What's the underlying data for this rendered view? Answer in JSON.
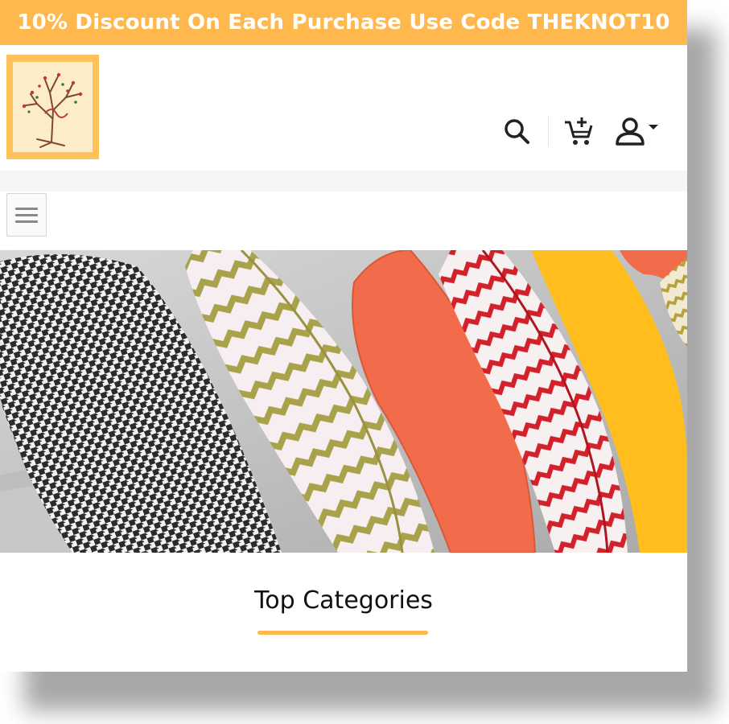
{
  "promo": {
    "text": "10% Discount On Each Purchase Use Code THEKNOT10"
  },
  "header": {
    "logo_alt": "The Knot",
    "icons": [
      "search-icon",
      "add-to-cart-icon",
      "user-account-icon"
    ]
  },
  "hero": {
    "alt": "Decorative cushions"
  },
  "sections": {
    "top_categories_title": "Top Categories"
  },
  "colors": {
    "accent": "#ffb84d",
    "logo_bg": "#ffc15a"
  }
}
